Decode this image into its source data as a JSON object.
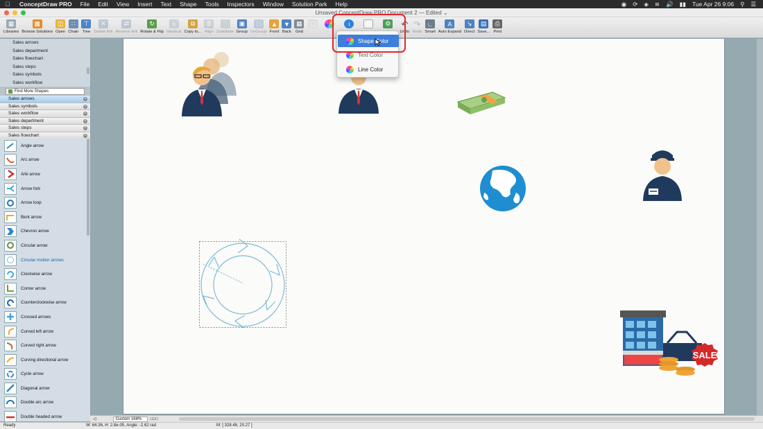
{
  "menubar": {
    "app_name": "ConceptDraw PRO",
    "items": [
      "File",
      "Edit",
      "View",
      "Insert",
      "Text",
      "Shape",
      "Tools",
      "Inspectors",
      "Window",
      "Solution Park",
      "Help"
    ],
    "clock": "Tue Apr 26  9:06"
  },
  "window": {
    "title": "Unsaved ConceptDraw PRO Document 2 — Edited ⌄"
  },
  "toolbar": {
    "buttons": [
      {
        "label": "Libraries",
        "icon": "libraries-icon",
        "color": "#9aa7b3"
      },
      {
        "label": "Browse Solutions",
        "icon": "solutions-icon",
        "color": "#e58b2a"
      },
      {
        "label": "Open",
        "icon": "folder-icon",
        "color": "#e8b33d"
      },
      {
        "label": "Chain",
        "icon": "chain-icon",
        "color": "#6d8fb4"
      },
      {
        "label": "Tree",
        "icon": "tree-icon",
        "color": "#4a86c6"
      },
      {
        "label": "Delete link",
        "icon": "delete-link-icon",
        "color": "#8aa0b8"
      },
      {
        "label": "Reverse link",
        "icon": "reverse-link-icon",
        "color": "#8aa0b8"
      },
      {
        "label": "Rotate & Flip",
        "icon": "rotate-icon",
        "color": "#5a9e4b"
      },
      {
        "label": "Identical",
        "icon": "identical-icon",
        "color": "#a8b4c0"
      },
      {
        "label": "Copy to...",
        "icon": "copy-icon",
        "color": "#d6a441"
      },
      {
        "label": "Align",
        "icon": "align-icon",
        "color": "#a8b4c0"
      },
      {
        "label": "Distribute",
        "icon": "distribute-icon",
        "color": "#a8b4c0"
      },
      {
        "label": "Group",
        "icon": "group-icon",
        "color": "#4f83c0"
      },
      {
        "label": "UnGroup",
        "icon": "ungroup-icon",
        "color": "#8aa6c8"
      },
      {
        "label": "Front",
        "icon": "front-icon",
        "color": "#e5a43a"
      },
      {
        "label": "Back",
        "icon": "back-icon",
        "color": "#4f83c0"
      },
      {
        "label": "Grid",
        "icon": "grid-icon",
        "color": "#7f8c96"
      }
    ],
    "buttons_right": [
      {
        "label": "Undo",
        "icon": "undo-icon",
        "color": "#555555"
      },
      {
        "label": "Redo",
        "icon": "redo-icon",
        "color": "#999999"
      },
      {
        "label": "Smart",
        "icon": "smart-icon",
        "color": "#6c7d8a"
      },
      {
        "label": "Auto Expand",
        "icon": "auto-expand-icon",
        "color": "#4f83c0"
      },
      {
        "label": "Direct",
        "icon": "direct-icon",
        "color": "#4f83c0"
      },
      {
        "label": "Save...",
        "icon": "save-icon",
        "color": "#3b6fb5"
      },
      {
        "label": "Print",
        "icon": "print-icon",
        "color": "#666666"
      }
    ],
    "partial_label": "t"
  },
  "dropdown": {
    "items": [
      "Shape Color",
      "Text Color",
      "Line Color"
    ]
  },
  "library_top_items": [
    "Sales arrows",
    "Sales department",
    "Sales flowchart",
    "Sales steps",
    "Sales symbols",
    "Sales workflow"
  ],
  "find_more": "Find More Shapes",
  "library_headers": [
    {
      "label": "Sales arrows",
      "active": true
    },
    {
      "label": "Sales symbols",
      "active": false
    },
    {
      "label": "Sales workflow",
      "active": false
    },
    {
      "label": "Sales department",
      "active": false
    },
    {
      "label": "Sales steps",
      "active": false
    },
    {
      "label": "Sales flowchart",
      "active": false
    }
  ],
  "shapes": [
    "Angle arrow",
    "Arc arrow",
    "Arki arrow",
    "Arrow fork",
    "Arrow loop",
    "Bent arrow",
    "Chevron arrow",
    "Circular arrow",
    "Circular motion arrows",
    "Clockwise arrow",
    "Corner arrow",
    "Counterclockwise arrow",
    "Crossed arrows",
    "Curved left arrow",
    "Curved right arrow",
    "Curving directional arrow",
    "Cycle arrow",
    "Diagonal arrow",
    "Double arc arrow",
    "Double headed arrow"
  ],
  "selected_shape": "Circular motion arrows",
  "canvas": {
    "sale_badge": "SALE"
  },
  "hscroll": {
    "zoom": "Custom 168%"
  },
  "status": {
    "ready": "Ready",
    "dims": "W: 64.36,  H: 2.8e-05,  Angle: -2.62 rad",
    "mouse": "M: [ 328.46, 20.27 ]"
  },
  "colors": {
    "accent": "#3d7ddc",
    "highlight_box": "#e3242b",
    "art_blue": "#1e8ed0",
    "navy": "#1f3a5c"
  }
}
